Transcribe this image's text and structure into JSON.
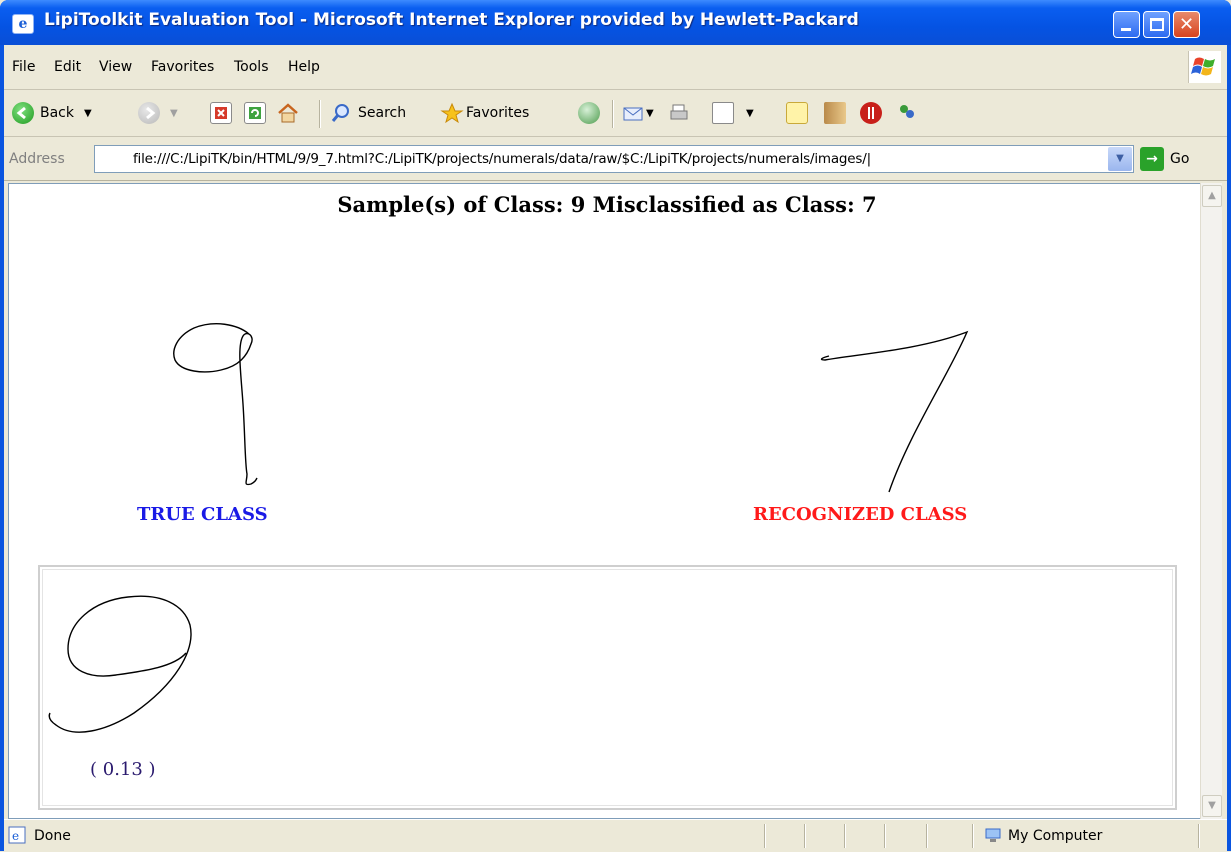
{
  "window": {
    "title": "LipiToolkit Evaluation Tool - Microsoft Internet Explorer provided by Hewlett-Packard",
    "colors": {
      "titlebar": "#0a55e0",
      "close": "#d8431e"
    }
  },
  "menu": {
    "items": [
      "File",
      "Edit",
      "View",
      "Favorites",
      "Tools",
      "Help"
    ]
  },
  "toolbar": {
    "back_label": "Back",
    "search_label": "Search",
    "favorites_label": "Favorites"
  },
  "address": {
    "label": "Address",
    "url": "file:///C:/LipiTK/bin/HTML/9/9_7.html?C:/LipiTK/projects/numerals/data/raw/$C:/LipiTK/projects/numerals/images/|",
    "go_label": "Go"
  },
  "page": {
    "heading": "Sample(s) of Class: 9 Misclassified as Class: 7",
    "true_class_label": "TRUE CLASS",
    "recognized_class_label": "RECOGNIZED CLASS",
    "colors": {
      "true_class": "#1a1ae6",
      "recognized_class": "#ff1a1a"
    },
    "samples": [
      {
        "score": "( 0.13 )"
      }
    ]
  },
  "status": {
    "text": "Done",
    "zone": "My Computer"
  }
}
